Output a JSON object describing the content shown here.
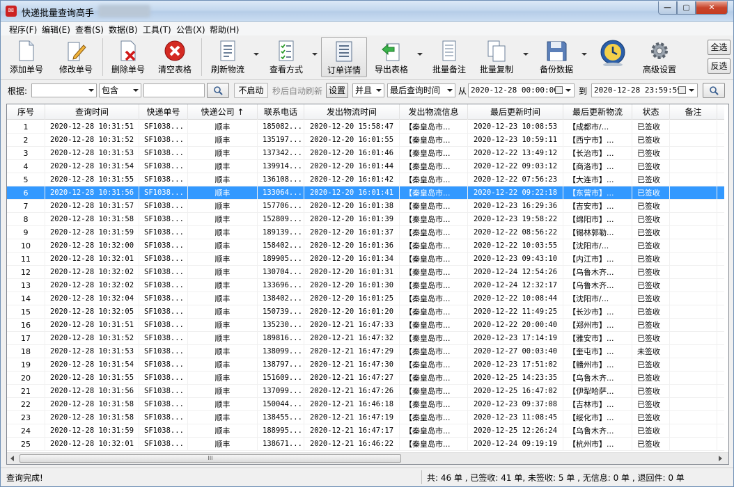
{
  "window": {
    "title": "快递批量查询高手"
  },
  "menu": [
    "程序(F)",
    "编辑(E)",
    "查看(S)",
    "数据(B)",
    "工具(T)",
    "公告(X)",
    "帮助(H)"
  ],
  "toolbar": {
    "buttons": [
      "添加单号",
      "修改单号",
      "删除单号",
      "清空表格",
      "刷新物流",
      "查看方式",
      "订单详情",
      "导出表格",
      "批量备注",
      "批量复制",
      "备份数据",
      "高级设置"
    ],
    "select_all": "全选",
    "invert": "反选"
  },
  "filter": {
    "label_basis": "根据:",
    "field_value": "",
    "match_value": "包含",
    "keyword_value": "",
    "auto_refresh_button": "不启动",
    "auto_refresh_text": "秒后自动刷新",
    "settings_button": "设置",
    "logic_value": "并且",
    "time_field_value": "最后查询时间",
    "from_label": "从",
    "from_value": "2020-12-28 00:00:00",
    "to_label": "到",
    "to_value": "2020-12-28 23:59:59"
  },
  "table": {
    "columns": [
      "序号",
      "查询时间",
      "快递单号",
      "快递公司 ↑",
      "联系电话",
      "发出物流时间",
      "发出物流信息",
      "最后更新时间",
      "最后更新物流",
      "状态",
      "备注"
    ],
    "selected_row": 6,
    "rows": [
      [
        "1",
        "2020-12-28 10:31:51",
        "SF1038...",
        "顺丰",
        "185082...",
        "2020-12-20 15:58:47",
        "【秦皇岛市...",
        "2020-12-23 10:08:53",
        "【成都市/...",
        "已签收",
        "",
        ""
      ],
      [
        "2",
        "2020-12-28 10:31:52",
        "SF1038...",
        "顺丰",
        "135197...",
        "2020-12-20 16:01:55",
        "【秦皇岛市...",
        "2020-12-23 10:59:11",
        "【西宁市】...",
        "已签收",
        "",
        ""
      ],
      [
        "3",
        "2020-12-28 10:31:53",
        "SF1038...",
        "顺丰",
        "137342...",
        "2020-12-20 16:01:46",
        "【秦皇岛市...",
        "2020-12-22 13:49:12",
        "【长治市】...",
        "已签收",
        "",
        ""
      ],
      [
        "4",
        "2020-12-28 10:31:54",
        "SF1038...",
        "顺丰",
        "139914...",
        "2020-12-20 16:01:44",
        "【秦皇岛市...",
        "2020-12-22 09:03:12",
        "【商洛市】...",
        "已签收",
        "",
        ""
      ],
      [
        "5",
        "2020-12-28 10:31:55",
        "SF1038...",
        "顺丰",
        "136108...",
        "2020-12-20 16:01:42",
        "【秦皇岛市...",
        "2020-12-22 07:56:23",
        "【大连市】...",
        "已签收",
        "",
        ""
      ],
      [
        "6",
        "2020-12-28 10:31:56",
        "SF1038...",
        "顺丰",
        "133064...",
        "2020-12-20 16:01:41",
        "【秦皇岛市...",
        "2020-12-22 09:22:18",
        "【东营市】...",
        "已签收",
        "",
        ""
      ],
      [
        "7",
        "2020-12-28 10:31:57",
        "SF1038...",
        "顺丰",
        "157706...",
        "2020-12-20 16:01:38",
        "【秦皇岛市...",
        "2020-12-23 16:29:36",
        "【吉安市】...",
        "已签收",
        "",
        ""
      ],
      [
        "8",
        "2020-12-28 10:31:58",
        "SF1038...",
        "顺丰",
        "152809...",
        "2020-12-20 16:01:39",
        "【秦皇岛市...",
        "2020-12-23 19:58:22",
        "【绵阳市】...",
        "已签收",
        "",
        ""
      ],
      [
        "9",
        "2020-12-28 10:31:59",
        "SF1038...",
        "顺丰",
        "189139...",
        "2020-12-20 16:01:37",
        "【秦皇岛市...",
        "2020-12-22 08:56:22",
        "【锡林郭勒...",
        "已签收",
        "",
        ""
      ],
      [
        "10",
        "2020-12-28 10:32:00",
        "SF1038...",
        "顺丰",
        "158402...",
        "2020-12-20 16:01:36",
        "【秦皇岛市...",
        "2020-12-22 10:03:55",
        "【沈阳市/...",
        "已签收",
        "",
        ""
      ],
      [
        "11",
        "2020-12-28 10:32:01",
        "SF1038...",
        "顺丰",
        "189905...",
        "2020-12-20 16:01:34",
        "【秦皇岛市...",
        "2020-12-23 09:43:10",
        "【内江市】...",
        "已签收",
        "",
        ""
      ],
      [
        "12",
        "2020-12-28 10:32:02",
        "SF1038...",
        "顺丰",
        "130704...",
        "2020-12-20 16:01:31",
        "【秦皇岛市...",
        "2020-12-24 12:54:26",
        "【乌鲁木齐...",
        "已签收",
        "",
        ""
      ],
      [
        "13",
        "2020-12-28 10:32:02",
        "SF1038...",
        "顺丰",
        "133696...",
        "2020-12-20 16:01:30",
        "【秦皇岛市...",
        "2020-12-24 12:32:17",
        "【乌鲁木齐...",
        "已签收",
        "",
        ""
      ],
      [
        "14",
        "2020-12-28 10:32:04",
        "SF1038...",
        "顺丰",
        "138402...",
        "2020-12-20 16:01:25",
        "【秦皇岛市...",
        "2020-12-22 10:08:44",
        "【沈阳市/...",
        "已签收",
        "",
        ""
      ],
      [
        "15",
        "2020-12-28 10:32:05",
        "SF1038...",
        "顺丰",
        "150739...",
        "2020-12-20 16:01:20",
        "【秦皇岛市...",
        "2020-12-22 11:49:25",
        "【长沙市】...",
        "已签收",
        "",
        ""
      ],
      [
        "16",
        "2020-12-28 10:31:51",
        "SF1038...",
        "顺丰",
        "135230...",
        "2020-12-21 16:47:33",
        "【秦皇岛市...",
        "2020-12-22 20:00:40",
        "【郑州市】...",
        "已签收",
        "",
        ""
      ],
      [
        "17",
        "2020-12-28 10:31:52",
        "SF1038...",
        "顺丰",
        "189816...",
        "2020-12-21 16:47:32",
        "【秦皇岛市...",
        "2020-12-23 17:14:19",
        "【雅安市】...",
        "已签收",
        "",
        ""
      ],
      [
        "18",
        "2020-12-28 10:31:53",
        "SF1038...",
        "顺丰",
        "138099...",
        "2020-12-21 16:47:29",
        "【秦皇岛市...",
        "2020-12-27 00:03:40",
        "【奎屯市】...",
        "未签收",
        "",
        ""
      ],
      [
        "19",
        "2020-12-28 10:31:54",
        "SF1038...",
        "顺丰",
        "138797...",
        "2020-12-21 16:47:30",
        "【秦皇岛市...",
        "2020-12-23 17:51:02",
        "【赣州市】...",
        "已签收",
        "",
        ""
      ],
      [
        "20",
        "2020-12-28 10:31:55",
        "SF1038...",
        "顺丰",
        "151609...",
        "2020-12-21 16:47:27",
        "【秦皇岛市...",
        "2020-12-25 14:23:35",
        "【乌鲁木齐...",
        "已签收",
        "",
        ""
      ],
      [
        "21",
        "2020-12-28 10:31:56",
        "SF1038...",
        "顺丰",
        "137099...",
        "2020-12-21 16:47:26",
        "【秦皇岛市...",
        "2020-12-25 16:47:02",
        "【伊犁哈萨...",
        "已签收",
        "",
        ""
      ],
      [
        "22",
        "2020-12-28 10:31:58",
        "SF1038...",
        "顺丰",
        "150044...",
        "2020-12-21 16:46:18",
        "【秦皇岛市...",
        "2020-12-23 09:37:08",
        "【吉林市】...",
        "已签收",
        "",
        ""
      ],
      [
        "23",
        "2020-12-28 10:31:58",
        "SF1038...",
        "顺丰",
        "138455...",
        "2020-12-21 16:47:19",
        "【秦皇岛市...",
        "2020-12-23 11:08:45",
        "【绥化市】...",
        "已签收",
        "",
        ""
      ],
      [
        "24",
        "2020-12-28 10:31:59",
        "SF1038...",
        "顺丰",
        "188995...",
        "2020-12-21 16:47:17",
        "【秦皇岛市...",
        "2020-12-25 12:26:24",
        "【乌鲁木齐...",
        "已签收",
        "",
        ""
      ],
      [
        "25",
        "2020-12-28 10:32:01",
        "SF1038...",
        "顺丰",
        "138671...",
        "2020-12-21 16:46:22",
        "【秦皇岛市...",
        "2020-12-24 09:19:19",
        "【杭州市】...",
        "已签收",
        "",
        ""
      ]
    ],
    "scroll_thumb": "III"
  },
  "status": {
    "left": "查询完成!",
    "right": "共: 46 单 , 已签收: 41 单, 未签收: 5 单 , 无信息: 0 单 , 退回件: 0 单"
  },
  "colors": {
    "selection": "#3399ff",
    "title_bar": "#c4d8ee",
    "close_button": "#c8452c"
  }
}
